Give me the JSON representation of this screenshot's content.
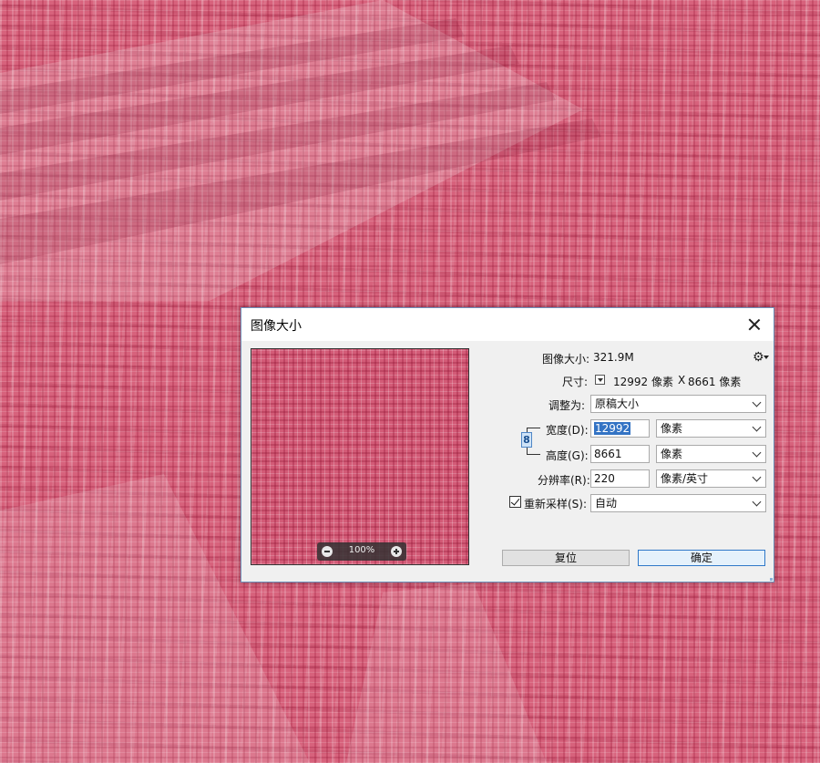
{
  "dialog": {
    "title": "图像大小",
    "image_size_label": "图像大小:",
    "image_size_value": "321.9M",
    "dimensions_label": "尺寸:",
    "dimensions_width": "12992 像素",
    "dimensions_x": "X",
    "dimensions_height": "8661 像素",
    "fit_to_label": "调整为:",
    "fit_to_value": "原稿大小",
    "width_label": "宽度(D):",
    "width_value": "12992",
    "width_unit": "像素",
    "height_label": "高度(G):",
    "height_value": "8661",
    "height_unit": "像素",
    "resolution_label": "分辨率(R):",
    "resolution_value": "220",
    "resolution_unit": "像素/英寸",
    "resample_label": "重新采样(S):",
    "resample_checked": true,
    "resample_value": "自动",
    "reset_label": "复位",
    "ok_label": "确定",
    "zoom_label": "100%",
    "link_icon_glyph": "8"
  },
  "icons": {
    "close": "close-icon",
    "gear": "gear-icon",
    "link": "link-chain-icon",
    "zoom_in": "zoom-in-icon",
    "zoom_out": "zoom-out-icon"
  },
  "colors": {
    "canvas": "#d7627c",
    "dialog_bg": "#f0f0f0",
    "dialog_border": "#6d8fb8",
    "selection": "#3373c4",
    "primary_border": "#2f78c8"
  }
}
